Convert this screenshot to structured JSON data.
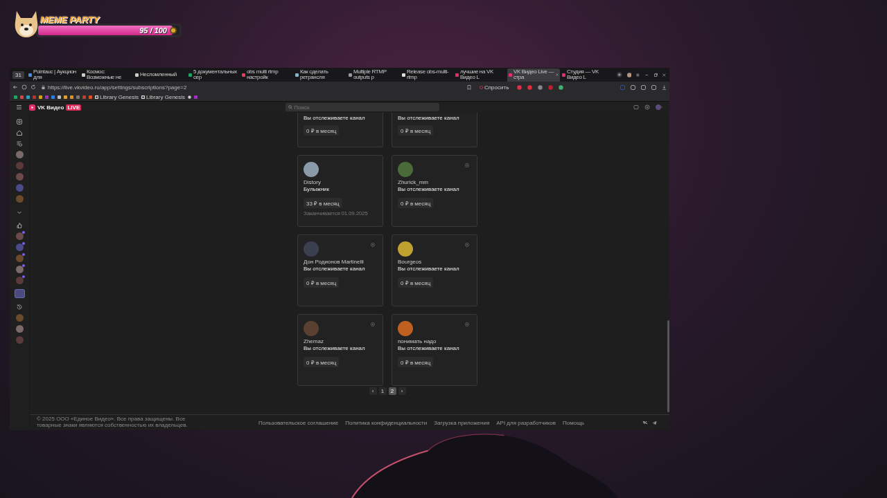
{
  "overlay": {
    "title": "MEME PARTY",
    "progress": {
      "level": 0.95,
      "reading": "95 / 100"
    }
  },
  "browser": {
    "tab_group": "31",
    "tabs": [
      {
        "title": "Pointauc | Аукцион для",
        "selected": false,
        "color": "#4a8fe0"
      },
      {
        "title": "Космос: Возможные не",
        "selected": false,
        "color": "#cccccc"
      },
      {
        "title": "Несломленный",
        "selected": false,
        "color": "#cccccc"
      },
      {
        "title": "5 документальных сер",
        "selected": false,
        "color": "#21a366"
      },
      {
        "title": "obs multi rtmp настройк",
        "selected": false,
        "color": "#e0405a"
      },
      {
        "title": "Как сделать ретрансля",
        "selected": false,
        "color": "#8ab4c8"
      },
      {
        "title": "Multiple RTMP outputs p",
        "selected": false,
        "color": "#999999"
      },
      {
        "title": "Release obs-multi-rtmp",
        "selected": false,
        "color": "#dddddd"
      },
      {
        "title": "лучшие на VK Видео L",
        "selected": false,
        "color": "#e0306a"
      },
      {
        "title": "VK Видео Live — стра",
        "selected": true,
        "color": "#e0306a"
      },
      {
        "title": "Студия — VK Видео L",
        "selected": false,
        "color": "#e0306a"
      }
    ],
    "url": "https://live.vkvideo.ru/app/settings/subscriptions?page=2",
    "ask_button": "Спросить",
    "bookmarks": [
      {
        "label": "Library Genesis"
      },
      {
        "label": "Library Genesis"
      }
    ]
  },
  "site": {
    "logo": "VK Видео",
    "live_badge": "LIVE",
    "search": {
      "placeholder": "Поиск"
    },
    "sidebar": [
      {
        "kind": "clips",
        "selected": false
      },
      {
        "kind": "home",
        "selected": false
      },
      {
        "kind": "subscriptions",
        "selected": false
      },
      {
        "kind": "avatar",
        "selected": false,
        "live": false
      },
      {
        "kind": "avatar",
        "selected": false,
        "live": false
      },
      {
        "kind": "avatar",
        "selected": false,
        "live": false
      },
      {
        "kind": "avatar",
        "selected": false,
        "live": false
      },
      {
        "kind": "avatar",
        "selected": false,
        "live": false
      },
      {
        "kind": "expand",
        "selected": false
      },
      {
        "kind": "likes",
        "selected": false
      },
      {
        "kind": "avatar",
        "selected": false,
        "live": true
      },
      {
        "kind": "avatar",
        "selected": false,
        "live": true
      },
      {
        "kind": "avatar",
        "selected": false,
        "live": true
      },
      {
        "kind": "avatar",
        "selected": false,
        "live": true
      },
      {
        "kind": "avatar",
        "selected": false,
        "live": true
      },
      {
        "kind": "tile",
        "selected": true
      },
      {
        "kind": "history",
        "selected": false
      },
      {
        "kind": "avatar",
        "selected": false,
        "live": false
      },
      {
        "kind": "avatar",
        "selected": false,
        "live": false
      },
      {
        "kind": "avatar",
        "selected": false,
        "live": false
      }
    ],
    "cards": [
      {
        "kind": "partial",
        "title": "Вы отслеживаете канал",
        "price": "0 ₽ в месяц",
        "removable": false
      },
      {
        "kind": "partial",
        "title": "Вы отслеживаете канал",
        "price": "0 ₽ в месяц",
        "removable": false
      },
      {
        "kind": "full",
        "name": "Distory",
        "title": "Булыжник",
        "price": "33 ₽ в месяц",
        "note": "Заканчивается 01.09.2025",
        "removable": false
      },
      {
        "kind": "full",
        "name": "Zhurick_mm",
        "title": "Вы отслеживаете канал",
        "price": "0 ₽ в месяц",
        "removable": true
      },
      {
        "kind": "full",
        "name": "Дон Родионов Martinelli",
        "title": "Вы отслеживаете канал",
        "price": "0 ₽ в месяц",
        "removable": true
      },
      {
        "kind": "full",
        "name": "Bourgeos",
        "title": "Вы отслеживаете канал",
        "price": "0 ₽ в месяц",
        "removable": true
      },
      {
        "kind": "full",
        "name": "Zhemaz",
        "title": "Вы отслеживаете канал",
        "price": "0 ₽ в месяц",
        "removable": true
      },
      {
        "kind": "full",
        "name": "понимать надо",
        "title": "Вы отслеживаете канал",
        "price": "0 ₽ в месяц",
        "removable": true
      }
    ],
    "pagination": {
      "prev": "‹",
      "next": "›",
      "pages": [
        {
          "label": "1",
          "selected": false
        },
        {
          "label": "2",
          "selected": true
        }
      ]
    },
    "footer": {
      "copyright": "© 2025 ООО «Единое Видео». Все права защищены. Все товарные знаки являются собственностью их владельцев.",
      "links": [
        "Пользовательское соглашение",
        "Политика конфиденциальности",
        "Загрузка приложения",
        "API для разработчиков",
        "Помощь"
      ]
    }
  }
}
